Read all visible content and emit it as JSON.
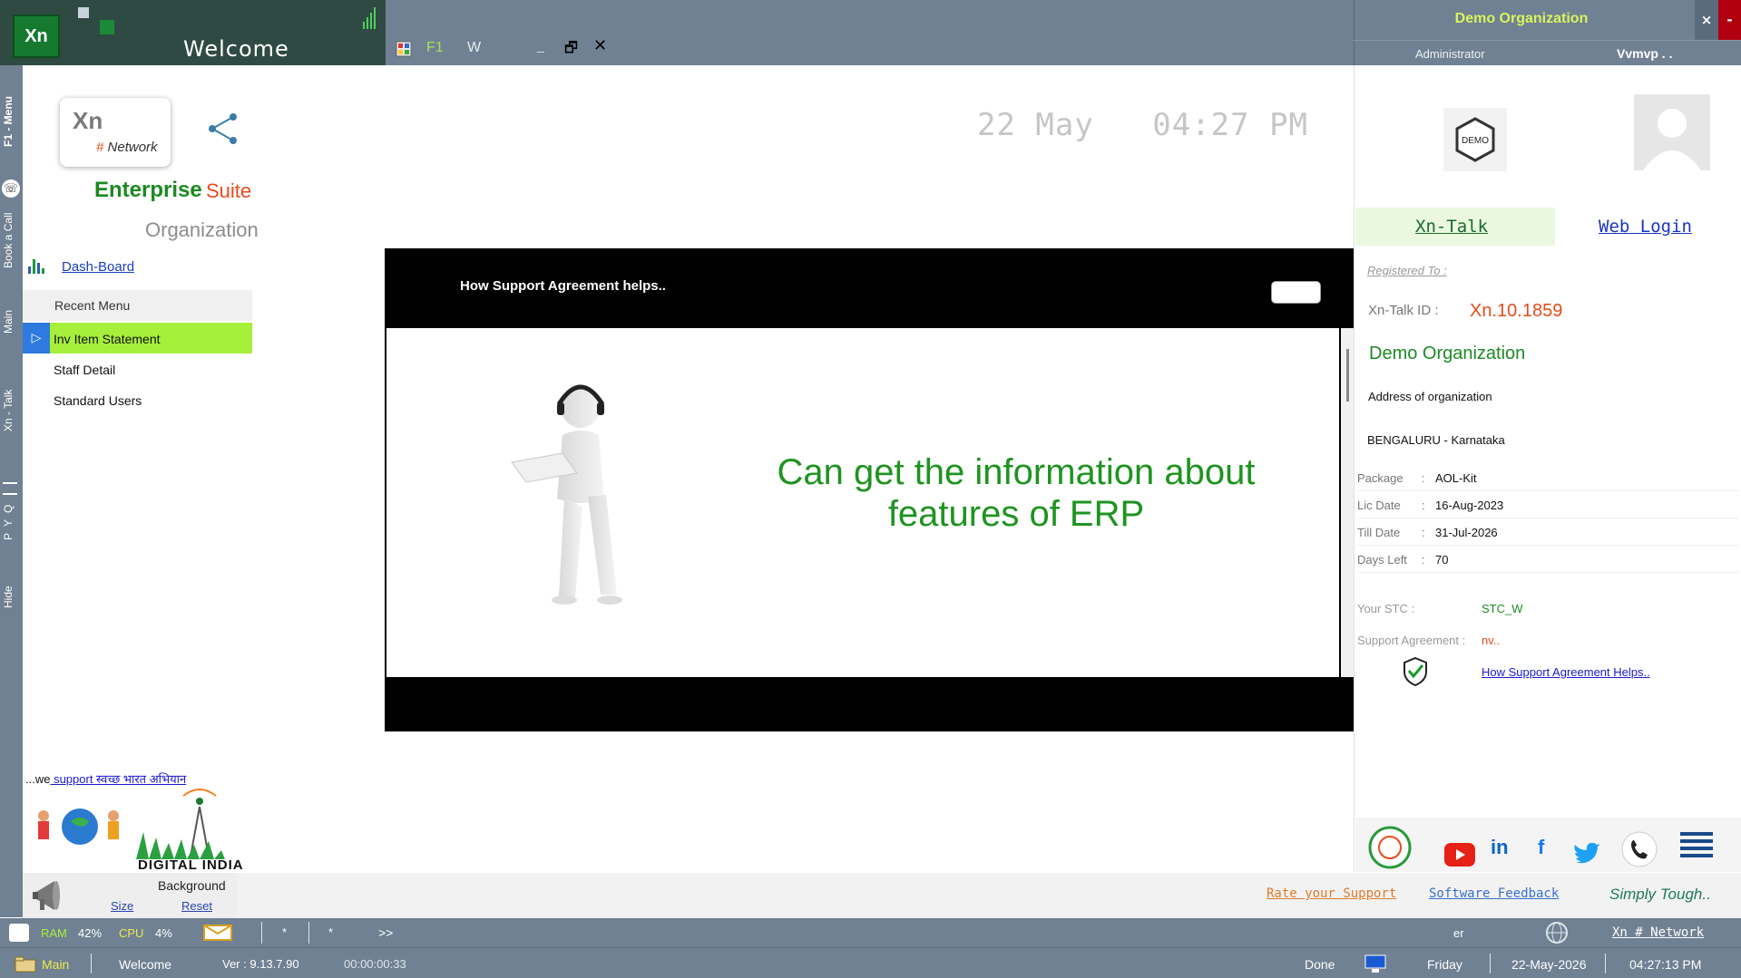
{
  "app": {
    "logo_text": "Xn",
    "window_title": "Welcome",
    "toolbar": {
      "f1": "F1",
      "w": "W",
      "minimize": "_",
      "restore": "🗗",
      "close": "✕"
    }
  },
  "header_right": {
    "org_name": "Demo Organization",
    "close_label": "×",
    "min_label": "-",
    "role": "Administrator",
    "user": "Vvmvp . ."
  },
  "vertical_tabs": [
    "F1 - Menu",
    "Book a Call",
    "Main",
    "Xn - Talk",
    "P Y Q",
    "Hide"
  ],
  "brand": {
    "xn": "Xn",
    "hash": "#",
    "network": "Network",
    "enterprise": "Enterprise",
    "suite": "Suite",
    "organization": "Organization"
  },
  "sidebar": {
    "dashboard": "Dash-Board",
    "recent_header": "Recent Menu",
    "recent_items": [
      "Inv Item Statement",
      "Staff Detail",
      "Standard Users"
    ]
  },
  "swachh": {
    "prefix": "...we",
    "link": " support स्वच्छ भारत अभियान"
  },
  "digital_india": "DIGITAL INDIA",
  "background": {
    "label": "Background",
    "size": "Size",
    "reset": "Reset"
  },
  "clock": {
    "date": "22 May",
    "time": "04:27 PM"
  },
  "modal": {
    "title": "How Support Agreement helps..",
    "message_line1": "Can get the information about",
    "message_line2": "features of ERP"
  },
  "right_panel": {
    "demo_logo": "DEMO",
    "xn_talk": "Xn-Talk",
    "web_login": "Web Login",
    "registered_to": "Registered To :",
    "xn_talk_id_label": "Xn-Talk ID :",
    "xn_talk_id": "Xn.10.1859",
    "org": "Demo Organization",
    "address": "Address of organization",
    "city": "BENGALURU - Karnataka",
    "info": [
      {
        "key": "Package",
        "value": "AOL-Kit"
      },
      {
        "key": "Lic Date",
        "value": "16-Aug-2023"
      },
      {
        "key": "Till Date",
        "value": "31-Jul-2026"
      },
      {
        "key": "Days Left",
        "value": "70"
      }
    ],
    "stc_label": "Your STC :",
    "stc": "STC_W",
    "support_label": "Support Agreement :",
    "support": "nv..",
    "how_support": "How Support Agreement Helps.."
  },
  "bottom_links": {
    "rate": "Rate your Support",
    "feedback": "Software Feedback",
    "tagline": "Simply Tough.."
  },
  "status1": {
    "ram_label": "RAM",
    "ram": "42%",
    "cpu_label": "CPU",
    "cpu": "4%",
    "star1": "*",
    "star2": "*",
    "more": ">>",
    "er": "er",
    "brand": "Xn # Network"
  },
  "status2": {
    "main": "Main",
    "welcome": "Welcome",
    "version": "Ver : 9.13.7.90",
    "timer": "00:00:00:33",
    "done": "Done",
    "day": "Friday",
    "date": "22-May-2026",
    "time": "04:27:13 PM"
  },
  "colors": {
    "accent_green": "#a6ef3a",
    "brand_green": "#1a8a20",
    "brand_orange": "#e84b1b",
    "bar": "#6f8193"
  }
}
